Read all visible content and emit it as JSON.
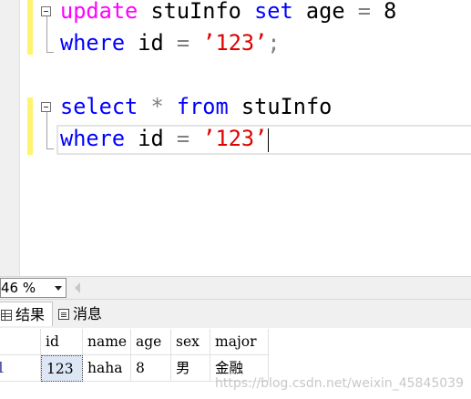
{
  "editor": {
    "lines": [
      {
        "kw1": "update",
        "t1": " stuInfo ",
        "kw2": "set",
        "t2": " age ",
        "op": "=",
        "t3": " 8"
      },
      {
        "kw1": "where",
        "t1": " id ",
        "op": "=",
        "t2": " ",
        "str": "’123’",
        "tail": ";"
      },
      {
        "kw1": "select",
        "t1": " ",
        "op": "*",
        "t2": " ",
        "kw2": "from",
        "t3": " stuInfo"
      },
      {
        "kw1": "where",
        "t1": " id ",
        "op": "=",
        "t2": " ",
        "str": "’123’"
      }
    ]
  },
  "zoom": {
    "value": "46 %"
  },
  "tabs": {
    "results": "结果",
    "messages": "消息"
  },
  "grid": {
    "columns": [
      "id",
      "name",
      "age",
      "sex",
      "major"
    ],
    "rows": [
      {
        "rownum": "1",
        "cells": [
          "123",
          "haha",
          "8",
          "男",
          "金融"
        ]
      }
    ]
  },
  "watermark": "https://blog.csdn.net/weixin_45845039",
  "colors": {
    "keyword": "#0000ff",
    "keyword_update": "#ff00ff",
    "string": "#e00000",
    "operator": "#808080",
    "change_bar": "#fff46e"
  }
}
